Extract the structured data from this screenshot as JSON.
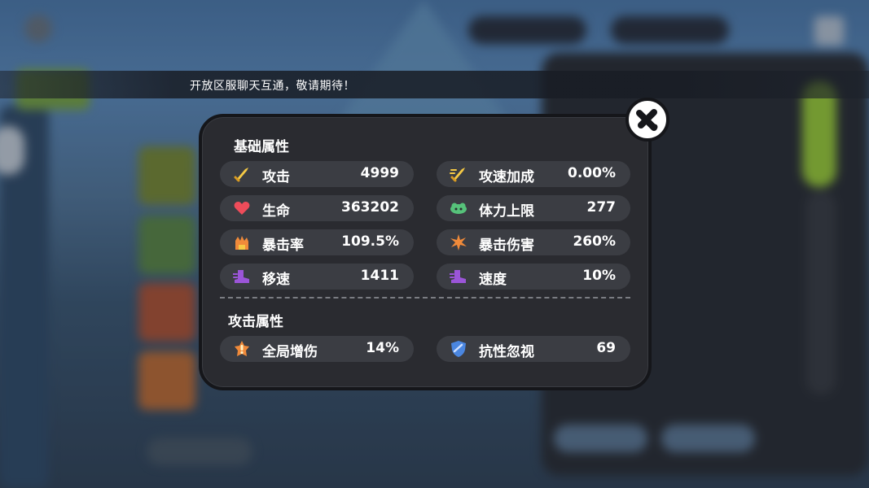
{
  "notice": {
    "text": "开放区服聊天互通，敬请期待！"
  },
  "popup": {
    "basic_title": "基础属性",
    "attack_title": "攻击属性",
    "basic_stats": [
      {
        "label": "攻击",
        "value": "4999",
        "icon": "sword-icon",
        "color": "#f5c945"
      },
      {
        "label": "攻速加成",
        "value": "0.00%",
        "icon": "speed-sword-icon",
        "color": "#f5c945"
      },
      {
        "label": "生命",
        "value": "363202",
        "icon": "heart-icon",
        "color": "#ef4c5a"
      },
      {
        "label": "体力上限",
        "value": "277",
        "icon": "stamina-icon",
        "color": "#56c27a"
      },
      {
        "label": "暴击率",
        "value": "109.5%",
        "icon": "crit-fist-icon",
        "color": "#f08a3a"
      },
      {
        "label": "暴击伤害",
        "value": "260%",
        "icon": "crit-burst-icon",
        "color": "#f08a3a"
      },
      {
        "label": "移速",
        "value": "1411",
        "icon": "boot-icon",
        "color": "#9b55d8"
      },
      {
        "label": "速度",
        "value": "10%",
        "icon": "boot-icon",
        "color": "#9b55d8"
      }
    ],
    "attack_stats": [
      {
        "label": "全局增伤",
        "value": "14%",
        "icon": "damage-up-icon",
        "color": "#f08a3a"
      },
      {
        "label": "抗性忽视",
        "value": "69",
        "icon": "shield-icon",
        "color": "#4a86e0"
      }
    ]
  }
}
